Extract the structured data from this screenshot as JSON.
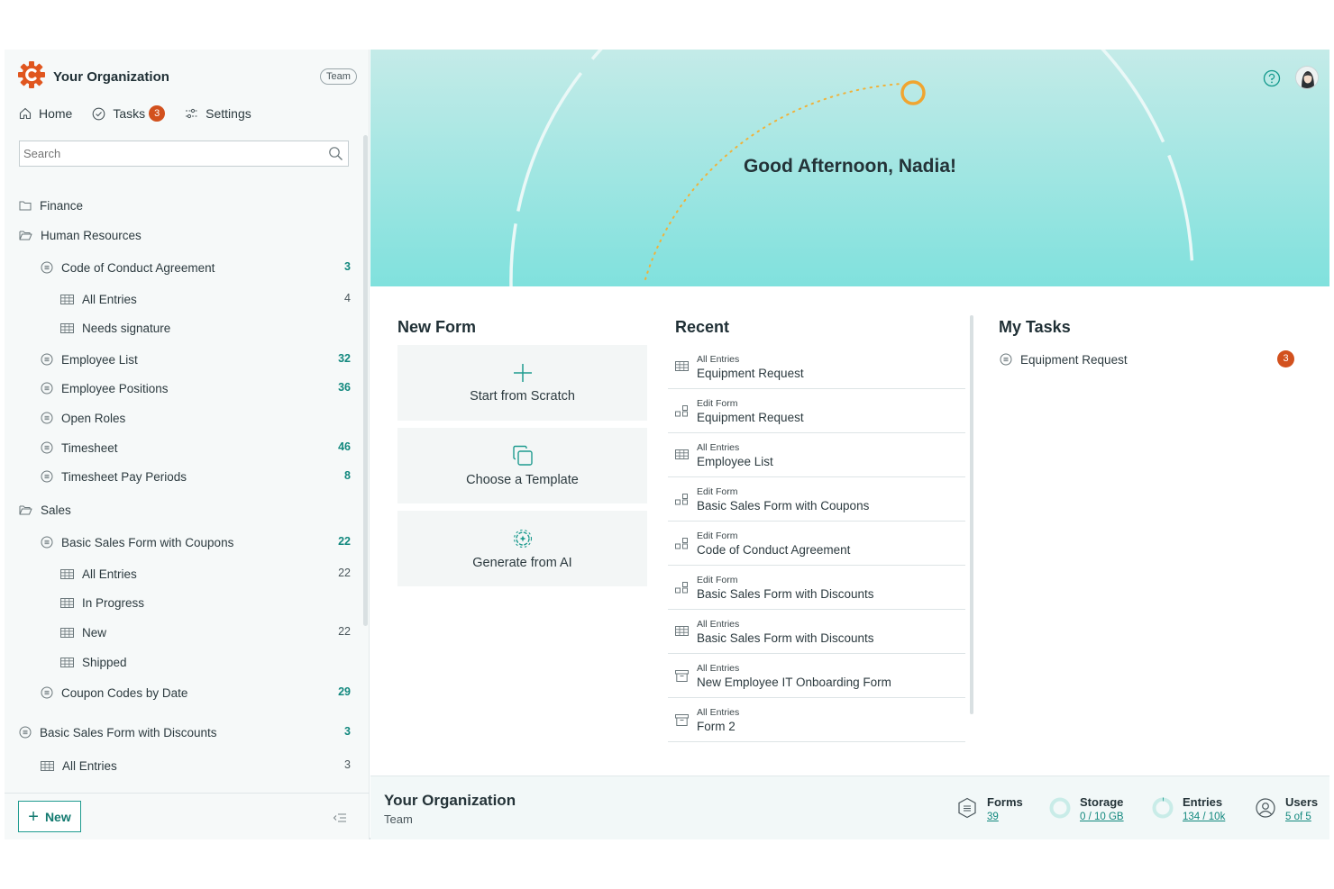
{
  "sidebar": {
    "org_name": "Your Organization",
    "plan": "Team",
    "nav": {
      "home": "Home",
      "tasks": "Tasks",
      "tasks_count": "3",
      "settings": "Settings"
    },
    "search_placeholder": "Search",
    "tree": [
      {
        "label": "Finance",
        "icon": "folder-icon",
        "count": ""
      },
      {
        "label": "Human Resources",
        "icon": "folder-open-icon",
        "count": ""
      },
      {
        "label": "Code of Conduct Agreement",
        "icon": "form-icon",
        "count": "3"
      },
      {
        "label": "All Entries",
        "icon": "table-icon",
        "count": "4"
      },
      {
        "label": "Needs signature",
        "icon": "table-icon",
        "count": ""
      },
      {
        "label": "Employee List",
        "icon": "form-icon",
        "count": "32"
      },
      {
        "label": "Employee Positions",
        "icon": "form-icon",
        "count": "36"
      },
      {
        "label": "Open Roles",
        "icon": "form-icon",
        "count": ""
      },
      {
        "label": "Timesheet",
        "icon": "form-icon",
        "count": "46"
      },
      {
        "label": "Timesheet Pay Periods",
        "icon": "form-icon",
        "count": "8"
      },
      {
        "label": "Sales",
        "icon": "folder-open-icon",
        "count": ""
      },
      {
        "label": "Basic Sales Form with Coupons",
        "icon": "form-icon",
        "count": "22"
      },
      {
        "label": "All Entries",
        "icon": "table-icon",
        "count": "22"
      },
      {
        "label": "In Progress",
        "icon": "table-icon",
        "count": ""
      },
      {
        "label": "New",
        "icon": "table-icon",
        "count": "22"
      },
      {
        "label": "Shipped",
        "icon": "table-icon",
        "count": ""
      },
      {
        "label": "Coupon Codes by Date",
        "icon": "form-icon",
        "count": "29"
      },
      {
        "label": "Basic Sales Form with Discounts",
        "icon": "form-icon",
        "count": "3"
      },
      {
        "label": "All Entries",
        "icon": "table-icon",
        "count": "3"
      }
    ],
    "new_button": "New"
  },
  "hero": {
    "greeting": "Good Afternoon, Nadia!"
  },
  "new_form": {
    "title": "New Form",
    "options": [
      "Start from Scratch",
      "Choose a Template",
      "Generate from AI"
    ]
  },
  "recent": {
    "title": "Recent",
    "items": [
      {
        "kind": "All Entries",
        "name": "Equipment Request",
        "icon": "table-icon"
      },
      {
        "kind": "Edit Form",
        "name": "Equipment Request",
        "icon": "edit-form-icon"
      },
      {
        "kind": "All Entries",
        "name": "Employee List",
        "icon": "table-icon"
      },
      {
        "kind": "Edit Form",
        "name": "Basic Sales Form with Coupons",
        "icon": "edit-form-icon"
      },
      {
        "kind": "Edit Form",
        "name": "Code of Conduct Agreement",
        "icon": "edit-form-icon"
      },
      {
        "kind": "Edit Form",
        "name": "Basic Sales Form with Discounts",
        "icon": "edit-form-icon"
      },
      {
        "kind": "All Entries",
        "name": "Basic Sales Form with Discounts",
        "icon": "table-icon"
      },
      {
        "kind": "All Entries",
        "name": "New Employee IT Onboarding Form",
        "icon": "archive-icon"
      },
      {
        "kind": "All Entries",
        "name": "Form 2",
        "icon": "archive-icon"
      }
    ]
  },
  "my_tasks": {
    "title": "My Tasks",
    "items": [
      {
        "name": "Equipment Request",
        "count": "3"
      }
    ]
  },
  "footer": {
    "org_name": "Your Organization",
    "plan": "Team",
    "stats": [
      {
        "label": "Forms",
        "value": "39"
      },
      {
        "label": "Storage",
        "value": "0 / 10 GB"
      },
      {
        "label": "Entries",
        "value": "134 / 10k"
      },
      {
        "label": "Users",
        "value": "5 of 5"
      }
    ]
  },
  "colors": {
    "accent": "#1e9b8f",
    "badge": "#d2511e",
    "hero_top": "#c4ebe8",
    "hero_bottom": "#80e1dd",
    "logo": "#e0561f"
  }
}
